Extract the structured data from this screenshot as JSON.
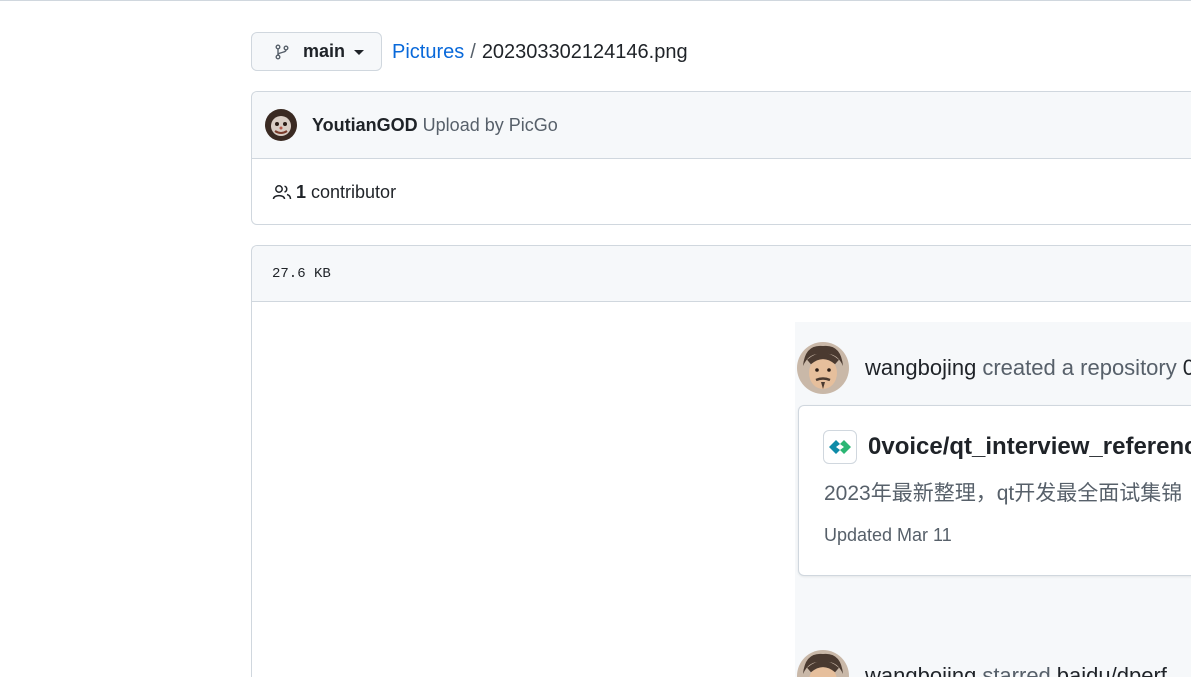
{
  "branch": {
    "label": "main"
  },
  "breadcrumb": {
    "folder": "Pictures",
    "separator": "/",
    "file": "202303302124146.png"
  },
  "commit": {
    "author": "YoutianGOD",
    "message": "Upload by PicGo",
    "contributor_count": "1",
    "contributor_label": "contributor"
  },
  "file": {
    "size": "27.6 KB"
  },
  "embedded_image": {
    "feed_item_1": {
      "user": "wangbojing",
      "action": "created a repository",
      "target_fragment": "0"
    },
    "repo_card": {
      "name": "0voice/qt_interview_referenc",
      "description": "2023年最新整理，qt开发最全面试集锦",
      "updated": "Updated Mar 11"
    },
    "feed_item_2": {
      "user": "wangbojing",
      "action": "starred",
      "target": "baidu/dperf"
    }
  },
  "icons": {
    "branch": "git-branch-icon",
    "caret": "triangle-down-icon",
    "people": "people-icon",
    "repo_logo": "repo-logo-icon"
  },
  "colors": {
    "link": "#0969da",
    "border": "#d0d7de",
    "muted": "#57606a",
    "header_bg": "#f6f8fa"
  }
}
